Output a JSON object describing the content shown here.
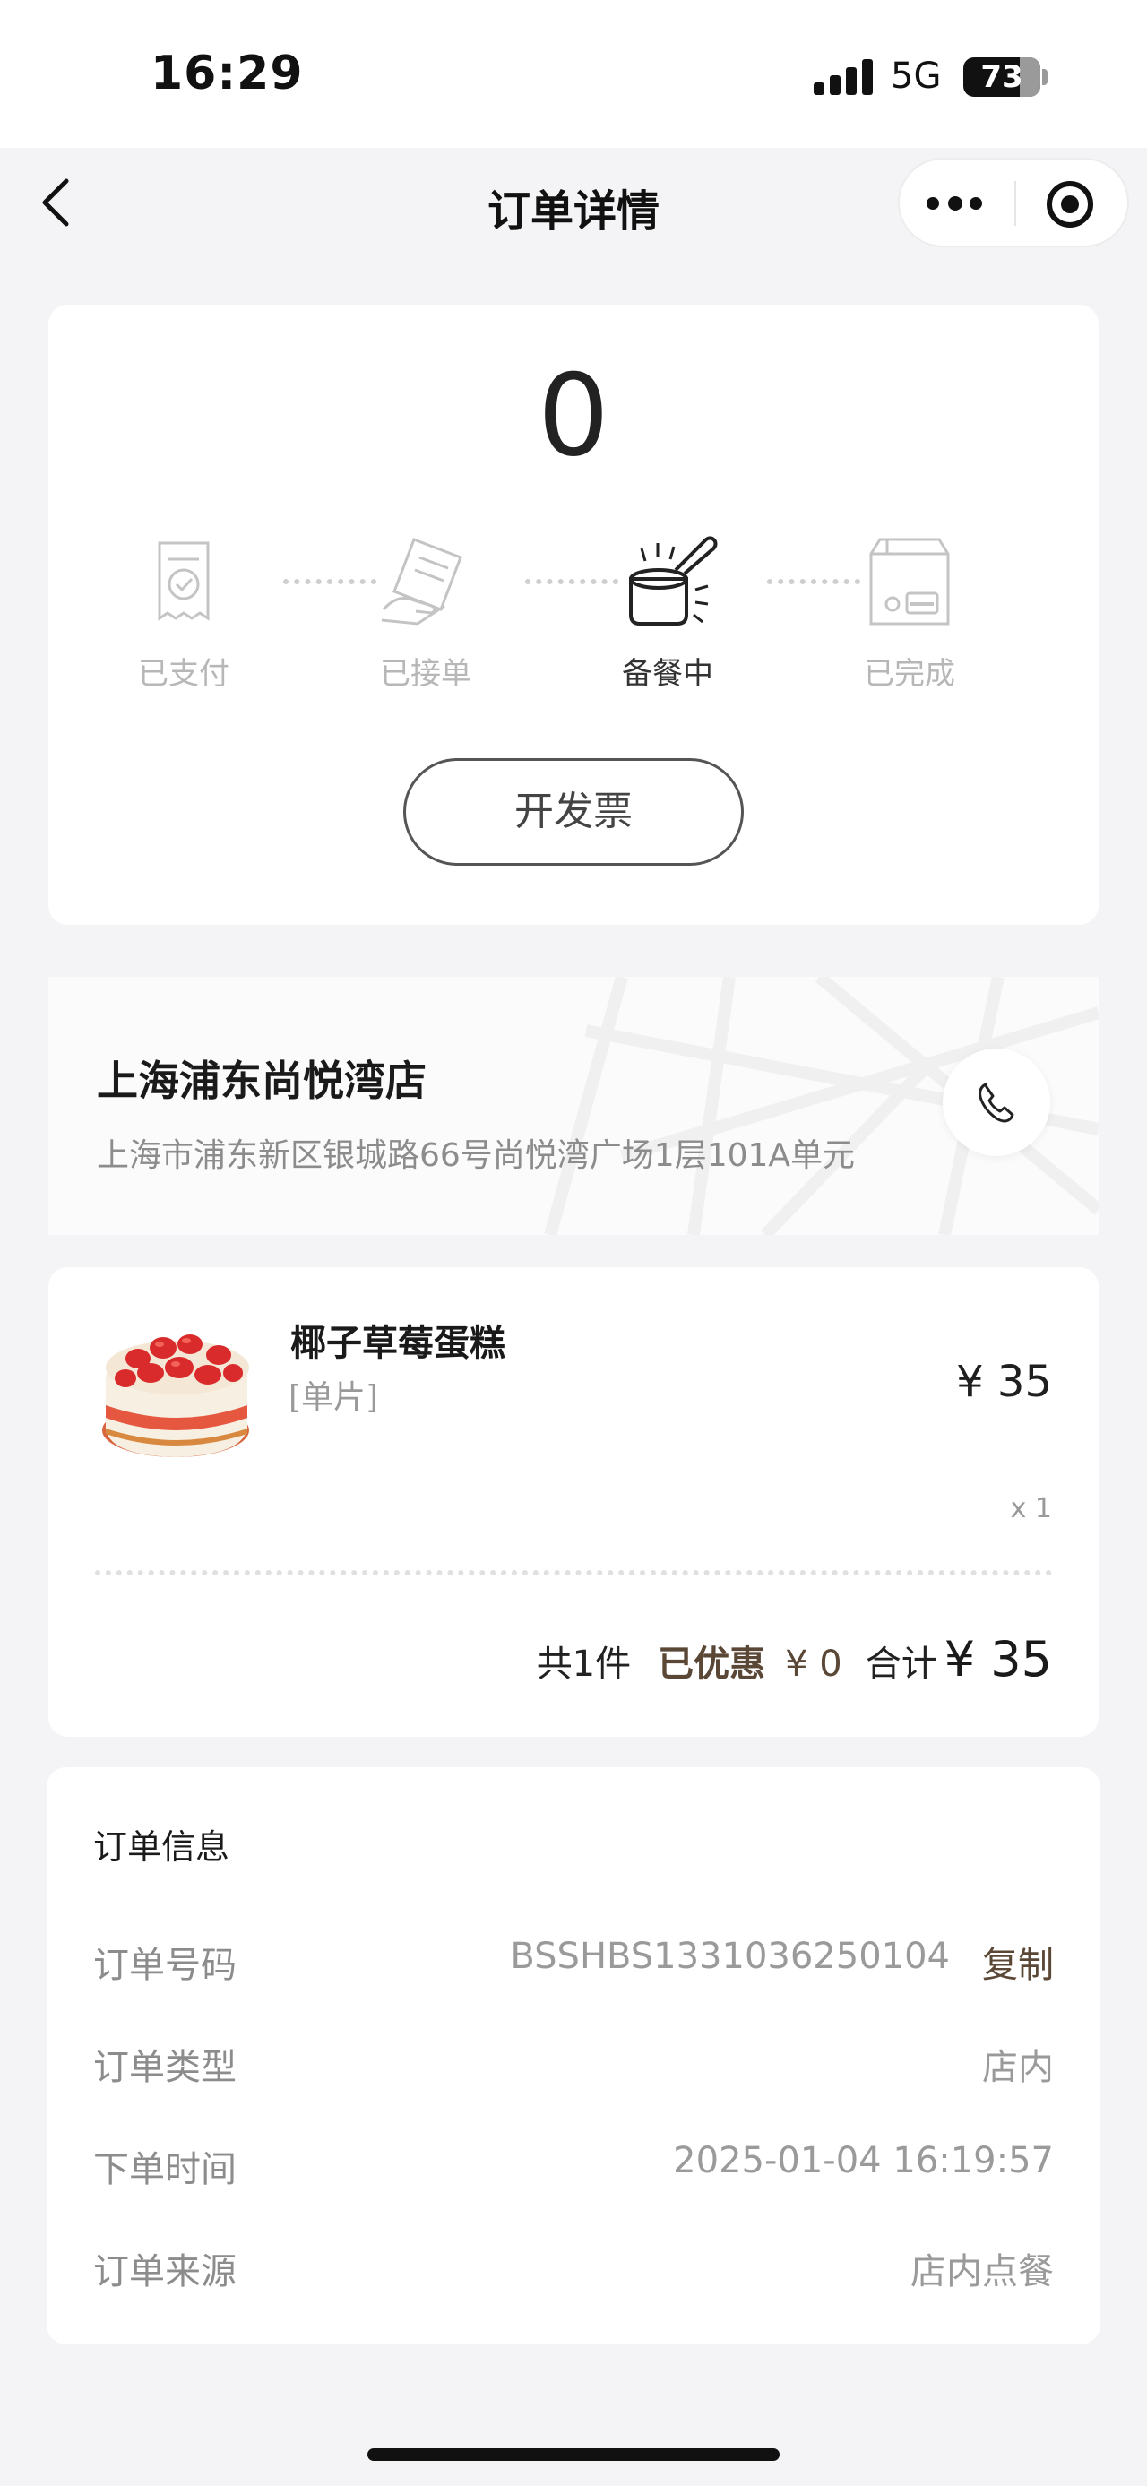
{
  "status_bar": {
    "time": "16:29",
    "network": "5G",
    "battery": "73",
    "battery_level": 0.73
  },
  "nav": {
    "title": "订单详情",
    "back_icon": "chevron-left-icon",
    "more_icon": "more-dots-icon",
    "close_icon": "target-circle-icon"
  },
  "order_status": {
    "pickup_number": "0",
    "steps": [
      {
        "label": "已支付",
        "icon": "receipt-check-icon",
        "active": false
      },
      {
        "label": "已接单",
        "icon": "receipt-hand-icon",
        "active": false
      },
      {
        "label": "备餐中",
        "icon": "cooking-pot-icon",
        "active": true
      },
      {
        "label": "已完成",
        "icon": "bag-card-icon",
        "active": false
      }
    ],
    "invoice_button": "开发票"
  },
  "store": {
    "name": "上海浦东尚悦湾店",
    "address": "上海市浦东新区银城路66号尚悦湾广场1层101A单元",
    "call_icon": "phone-icon"
  },
  "product": {
    "name": "椰子草莓蛋糕",
    "spec": "[单片]",
    "price": "¥ 35",
    "quantity": "x 1",
    "image_icon": "strawberry-cake-image"
  },
  "summary": {
    "count": "共1件",
    "discount_label": "已优惠",
    "discount_value": "¥ 0",
    "total_label": "合计",
    "total_value": "¥ 35"
  },
  "order_info": {
    "title": "订单信息",
    "rows": [
      {
        "label": "订单号码",
        "value": "BSSHBS1331036250104",
        "action": "复制"
      },
      {
        "label": "订单类型",
        "value": "店内"
      },
      {
        "label": "下单时间",
        "value": "2025-01-04 16:19:57"
      },
      {
        "label": "订单来源",
        "value": "店内点餐"
      }
    ]
  },
  "colors": {
    "accent_brown": "#5a4736",
    "inactive_gray": "#b7b7b7",
    "page_background": "#f4f4f6"
  }
}
